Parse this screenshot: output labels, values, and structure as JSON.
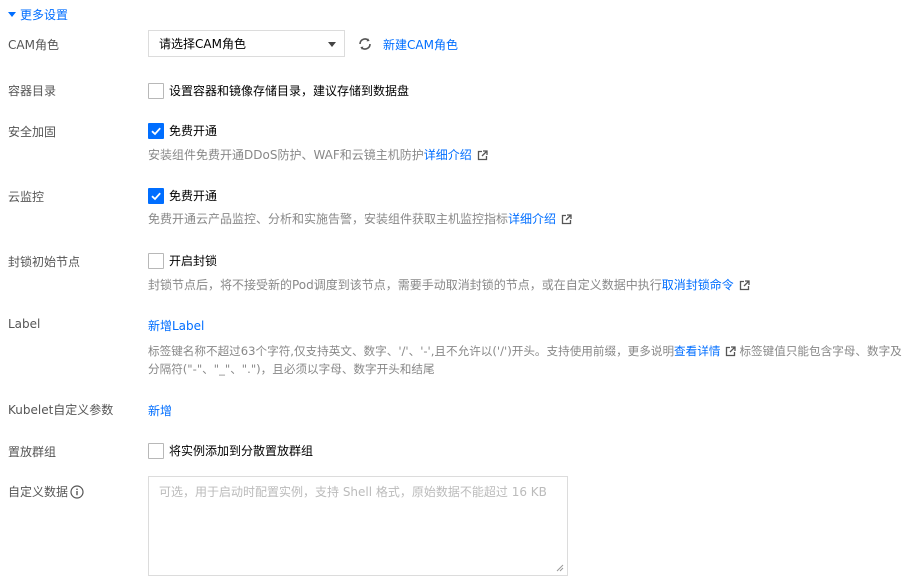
{
  "section": {
    "title": "更多设置"
  },
  "cam": {
    "label": "CAM角色",
    "select_value": "请选择CAM角色",
    "new_link": "新建CAM角色"
  },
  "container_dir": {
    "label": "容器目录",
    "checkbox_text": "设置容器和镜像存储目录，建议存储到数据盘",
    "checked": false
  },
  "security": {
    "label": "安全加固",
    "checkbox_text": "免费开通",
    "checked": true,
    "hint": "安装组件免费开通DDoS防护、WAF和云镜主机防护",
    "hint_link": "详细介绍"
  },
  "monitor": {
    "label": "云监控",
    "checkbox_text": "免费开通",
    "checked": true,
    "hint": "免费开通云产品监控、分析和实施告警，安装组件获取主机监控指标",
    "hint_link": "详细介绍"
  },
  "cordon": {
    "label": "封锁初始节点",
    "checkbox_text": "开启封锁",
    "checked": false,
    "hint": "封锁节点后，将不接受新的Pod调度到该节点，需要手动取消封锁的节点，或在自定义数据中执行",
    "hint_link": "取消封锁命令"
  },
  "label_field": {
    "label": "Label",
    "add_link": "新增Label",
    "hint_line1_a": "标签键名称不超过63个字符,仅支持英文、数字、'/'、'-',且不允许以('/')开头。支持使用前缀，更多说明",
    "hint_link": "查看详情",
    "hint_line1_b": "标签键值只能包含字母、数字及",
    "hint_line2": "分隔符(\"-\"、\"_\"、\".\")，且必须以字母、数字开头和结尾"
  },
  "kubelet": {
    "label": "Kubelet自定义参数",
    "add_link": "新增"
  },
  "placement": {
    "label": "置放群组",
    "checkbox_text": "将实例添加到分散置放群组",
    "checked": false
  },
  "custom_data": {
    "label": "自定义数据",
    "placeholder": "可选，用于启动时配置实例，支持 Shell 格式，原始数据不能超过 16 KB"
  },
  "colors": {
    "accent": "#006eff",
    "label": "#555555",
    "hint": "#888888"
  }
}
